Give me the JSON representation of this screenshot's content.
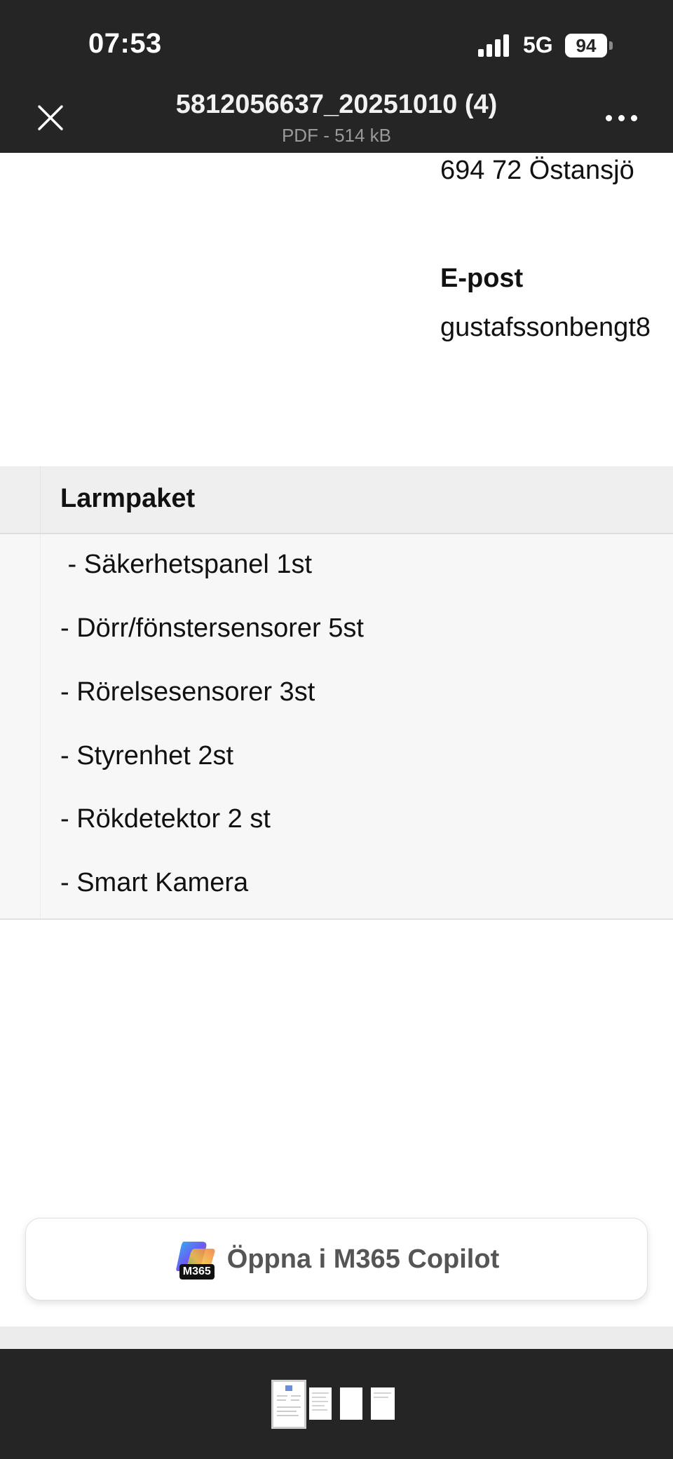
{
  "status_bar": {
    "time": "07:53",
    "network": "5G",
    "battery": "94"
  },
  "header": {
    "title": "5812056637_20251010 (4)",
    "subtitle": "PDF - 514 kB"
  },
  "document": {
    "address_line": "694 72 Östansjö",
    "email_label": "E-post",
    "email_value": "gustafssonbengt8",
    "package": {
      "title": "Larmpaket",
      "items": [
        " - Säkerhetspanel 1st",
        "- Dörr/fönstersensorer 5st",
        "- Rörelsesensorer 3st",
        "- Styrenhet 2st",
        "- Rökdetektor 2 st",
        "- Smart Kamera"
      ]
    }
  },
  "copilot": {
    "label": "Öppna i M365 Copilot",
    "badge": "M365"
  },
  "thumbnails": {
    "count": 4,
    "active_index": 0
  },
  "colors": {
    "header_bg": "#252525",
    "table_header_bg": "#efefef",
    "table_body_bg": "#f7f7f7"
  }
}
